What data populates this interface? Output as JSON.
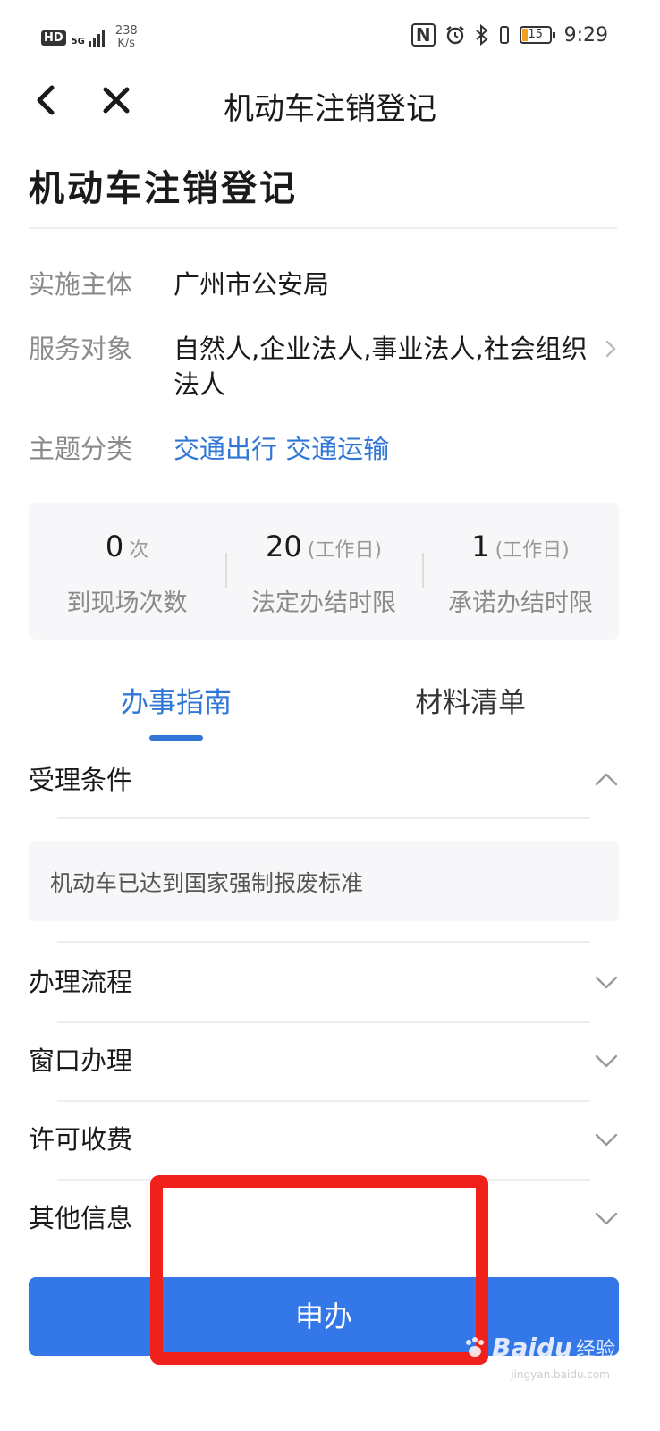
{
  "status_bar": {
    "hd": "HD",
    "network": "5G",
    "speed_value": "238",
    "speed_unit": "K/s",
    "nfc": "N",
    "battery_level": "15",
    "time": "9:29"
  },
  "nav": {
    "title": "机动车注销登记"
  },
  "page": {
    "heading": "机动车注销登记"
  },
  "info": [
    {
      "label": "实施主体",
      "value": "广州市公安局"
    },
    {
      "label": "服务对象",
      "value": "自然人,企业法人,事业法人,社会组织法人"
    },
    {
      "label": "主题分类",
      "value": "交通出行 交通运输"
    }
  ],
  "stats": [
    {
      "num": "0",
      "unit": "次",
      "label": "到现场次数"
    },
    {
      "num": "20",
      "unit": "(工作日)",
      "label": "法定办结时限"
    },
    {
      "num": "1",
      "unit": "(工作日)",
      "label": "承诺办结时限"
    }
  ],
  "tabs": [
    {
      "label": "办事指南",
      "active": true
    },
    {
      "label": "材料清单",
      "active": false
    }
  ],
  "sections": [
    {
      "title": "受理条件",
      "expanded": true,
      "content": "机动车已达到国家强制报废标准"
    },
    {
      "title": "办理流程",
      "expanded": false
    },
    {
      "title": "窗口办理",
      "expanded": false
    },
    {
      "title": "许可收费",
      "expanded": false
    },
    {
      "title": "其他信息",
      "expanded": false
    }
  ],
  "apply": {
    "label": "申办"
  },
  "watermark": {
    "brand": "Baidu",
    "cn": "经验",
    "sub": "jingyan.baidu.com"
  },
  "colors": {
    "accent": "#2f76d6",
    "button": "#3377e8",
    "annotation": "#f0201b"
  }
}
